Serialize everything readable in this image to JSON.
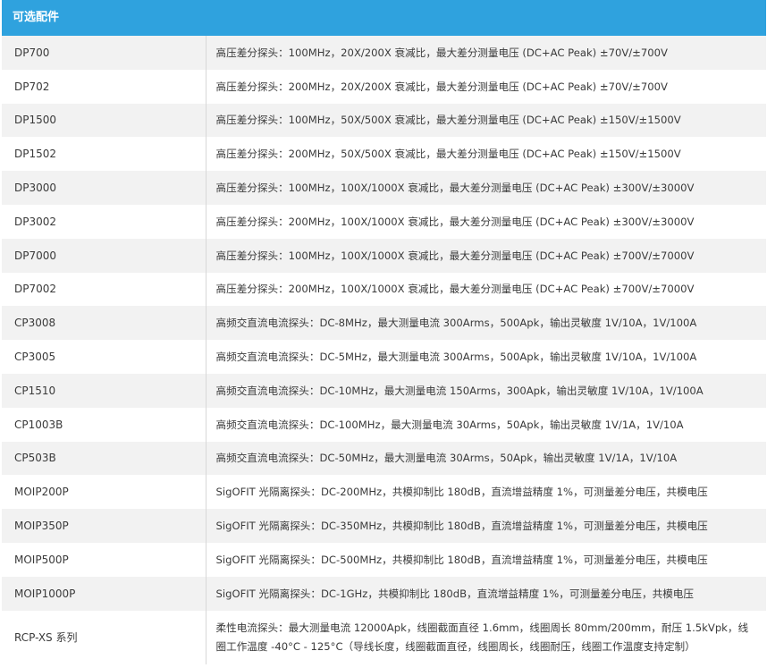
{
  "header": {
    "title": "可选配件"
  },
  "rows": [
    {
      "model": "DP700",
      "desc": "高压差分探头：100MHz，20X/200X 衰减比，最大差分测量电压 (DC+AC Peak) ±70V/±700V"
    },
    {
      "model": "DP702",
      "desc": "高压差分探头：200MHz，20X/200X 衰减比，最大差分测量电压 (DC+AC Peak) ±70V/±700V"
    },
    {
      "model": "DP1500",
      "desc": "高压差分探头：100MHz，50X/500X 衰减比，最大差分测量电压 (DC+AC Peak) ±150V/±1500V"
    },
    {
      "model": "DP1502",
      "desc": "高压差分探头：200MHz，50X/500X 衰减比，最大差分测量电压 (DC+AC Peak) ±150V/±1500V"
    },
    {
      "model": "DP3000",
      "desc": "高压差分探头：100MHz，100X/1000X 衰减比，最大差分测量电压 (DC+AC Peak) ±300V/±3000V"
    },
    {
      "model": "DP3002",
      "desc": "高压差分探头：200MHz，100X/1000X 衰减比，最大差分测量电压 (DC+AC Peak) ±300V/±3000V"
    },
    {
      "model": "DP7000",
      "desc": "高压差分探头：100MHz，100X/1000X 衰减比，最大差分测量电压 (DC+AC Peak) ±700V/±7000V"
    },
    {
      "model": "DP7002",
      "desc": "高压差分探头：200MHz，100X/1000X 衰减比，最大差分测量电压 (DC+AC Peak) ±700V/±7000V"
    },
    {
      "model": "CP3008",
      "desc": "高频交直流电流探头：DC-8MHz，最大测量电流 300Arms，500Apk，输出灵敏度 1V/10A，1V/100A"
    },
    {
      "model": "CP3005",
      "desc": "高频交直流电流探头：DC-5MHz，最大测量电流 300Arms，500Apk，输出灵敏度 1V/10A，1V/100A"
    },
    {
      "model": "CP1510",
      "desc": "高频交直流电流探头：DC-10MHz，最大测量电流 150Arms，300Apk，输出灵敏度 1V/10A，1V/100A"
    },
    {
      "model": "CP1003B",
      "desc": "高频交直流电流探头：DC-100MHz，最大测量电流 30Arms，50Apk，输出灵敏度 1V/1A，1V/10A"
    },
    {
      "model": "CP503B",
      "desc": "高频交直流电流探头：DC-50MHz，最大测量电流 30Arms，50Apk，输出灵敏度 1V/1A，1V/10A"
    },
    {
      "model": "MOIP200P",
      "desc": "SigOFIT 光隔离探头：DC-200MHz，共模抑制比 180dB，直流增益精度 1%，可测量差分电压，共模电压"
    },
    {
      "model": "MOIP350P",
      "desc": "SigOFIT 光隔离探头：DC-350MHz，共模抑制比 180dB，直流增益精度 1%，可测量差分电压，共模电压"
    },
    {
      "model": "MOIP500P",
      "desc": "SigOFIT 光隔离探头：DC-500MHz，共模抑制比 180dB，直流增益精度 1%，可测量差分电压，共模电压"
    },
    {
      "model": "MOIP1000P",
      "desc": "SigOFIT 光隔离探头：DC-1GHz，共模抑制比 180dB，直流增益精度 1%，可测量差分电压，共模电压"
    },
    {
      "model": "RCP-XS 系列",
      "desc": "柔性电流探头：最大测量电流 12000Apk，线圈截面直径 1.6mm，线圈周长 80mm/200mm，耐压 1.5kVpk，线圈工作温度 -40°C - 125°C（导线长度，线圈截面直径，线圈周长，线圈耐压，线圈工作温度支持定制）"
    }
  ]
}
